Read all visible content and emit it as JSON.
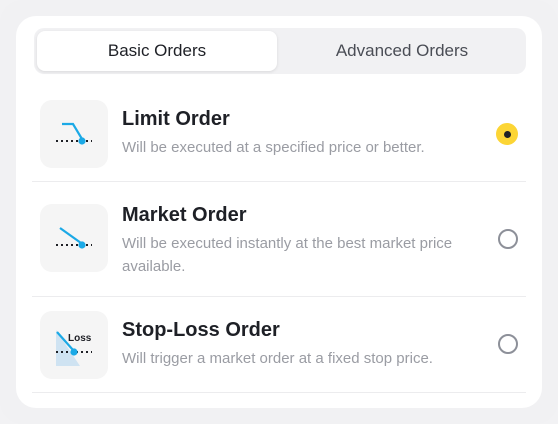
{
  "tabs": [
    {
      "label": "Basic Orders",
      "active": true
    },
    {
      "label": "Advanced Orders",
      "active": false
    }
  ],
  "options": [
    {
      "title": "Limit Order",
      "description": "Will be executed at a specified price or better.",
      "selected": true,
      "icon": "limit-order-icon"
    },
    {
      "title": "Market Order",
      "description": "Will be executed instantly at the best market price available.",
      "selected": false,
      "icon": "market-order-icon"
    },
    {
      "title": "Stop-Loss Order",
      "description": "Will trigger a market order at a fixed stop price.",
      "selected": false,
      "icon": "stop-loss-order-icon",
      "icon_text": "Loss"
    }
  ],
  "colors": {
    "accent": "#fcd535",
    "icon_blue": "#1ba9e6",
    "text_primary": "#1e2026",
    "text_secondary": "#9a9ca3"
  }
}
